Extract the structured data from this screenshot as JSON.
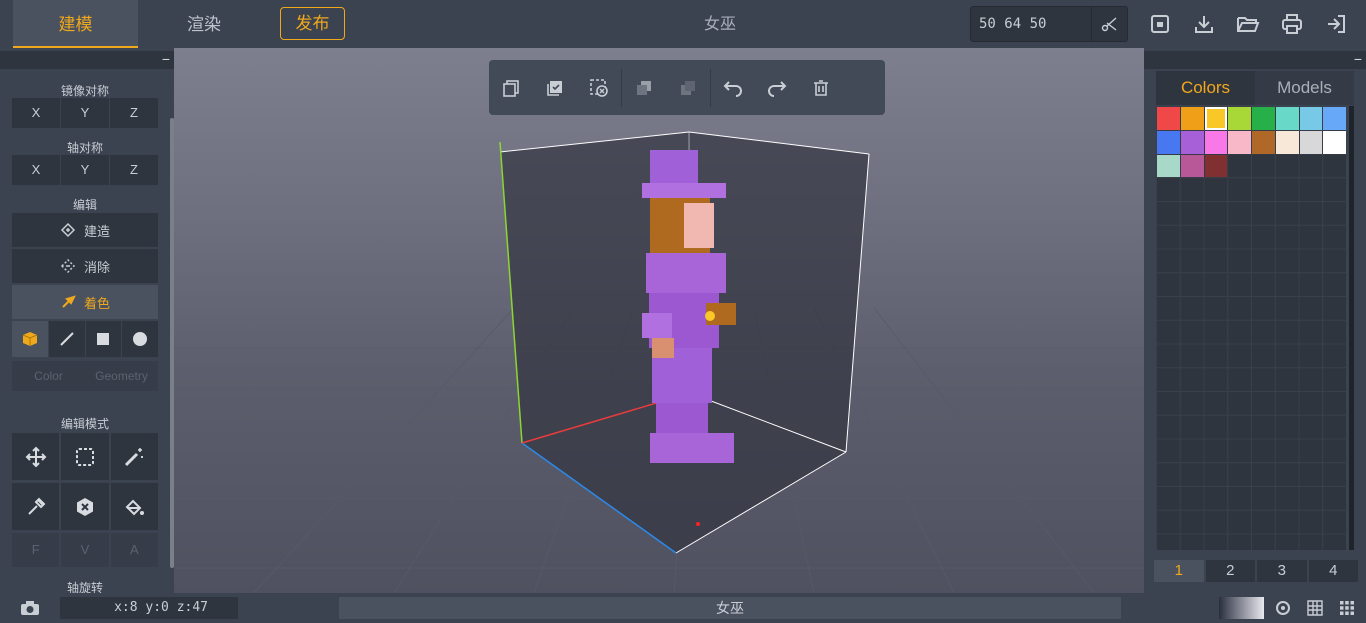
{
  "topbar": {
    "tabs": [
      "建模",
      "渲染"
    ],
    "publish": "发布",
    "title": "女巫",
    "dimensions": "50 64 50"
  },
  "left_panel": {
    "mirror_label": "镜像对称",
    "mirror_axes": [
      "X",
      "Y",
      "Z"
    ],
    "axis_label": "轴对称",
    "axis_axes": [
      "X",
      "Y",
      "Z"
    ],
    "edit_label": "编辑",
    "edit_buttons": [
      "建造",
      "消除",
      "着色"
    ],
    "color_tab": "Color",
    "geometry_tab": "Geometry",
    "mode_label": "编辑模式",
    "fva": [
      "F",
      "V",
      "A"
    ],
    "rotate_label": "轴旋转"
  },
  "right_panel": {
    "tabs": [
      "Colors",
      "Models"
    ],
    "palette": [
      "#f04848",
      "#f0a018",
      "#f8c828",
      "#a8d838",
      "#28b048",
      "#68d8c8",
      "#78c8e8",
      "#68a8f8",
      "#4878f0",
      "#a860d8",
      "#f878e8",
      "#f8b8c8",
      "#b06828",
      "#f8e8d8",
      "#d8d8d8",
      "#ffffff",
      "#a8d8c8",
      "#b85898",
      "#803030"
    ],
    "pages": [
      "1",
      "2",
      "3",
      "4"
    ]
  },
  "bottom": {
    "coords": "x:8 y:0 z:47",
    "name": "女巫"
  },
  "colors": {
    "accent": "#f0a81c",
    "panel": "#3b4250",
    "dark": "#2f353f"
  }
}
